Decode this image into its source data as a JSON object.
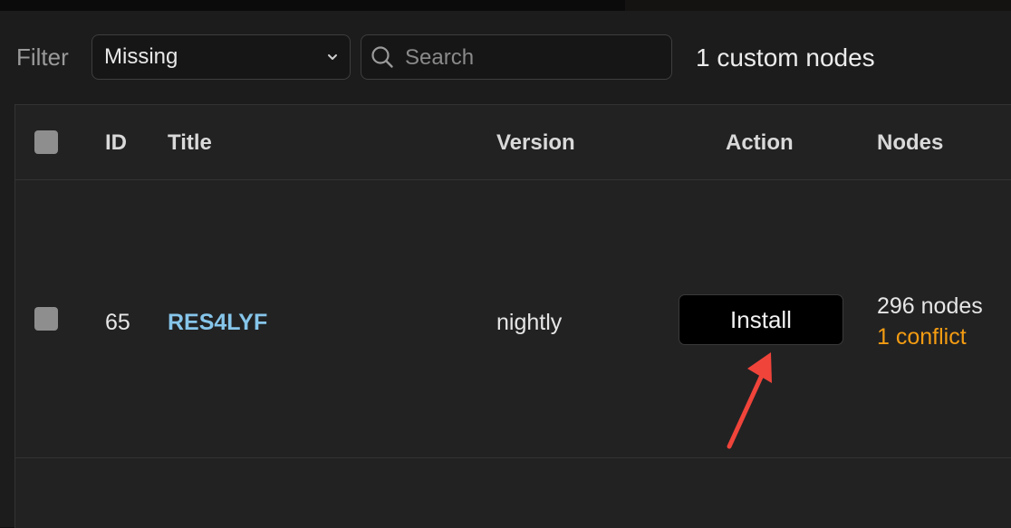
{
  "toolbar": {
    "filter_label": "Filter",
    "filter_selected": "Missing",
    "search_placeholder": "Search",
    "search_value": "",
    "count_text": "1 custom nodes"
  },
  "table": {
    "columns": {
      "id": "ID",
      "title": "Title",
      "version": "Version",
      "action": "Action",
      "nodes": "Nodes"
    },
    "rows": [
      {
        "id": "65",
        "title": "RES4LYF",
        "version": "nightly",
        "action_label": "Install",
        "nodes_text": "296 nodes",
        "conflict_text": "1 conflict"
      }
    ]
  },
  "colors": {
    "title_link": "#86c5ea",
    "conflict": "#f39c12",
    "annotation_arrow": "#f0443a"
  },
  "icons": {
    "select_chevron": "chevron-down-icon",
    "search": "search-icon",
    "annotation": "arrow-icon"
  }
}
